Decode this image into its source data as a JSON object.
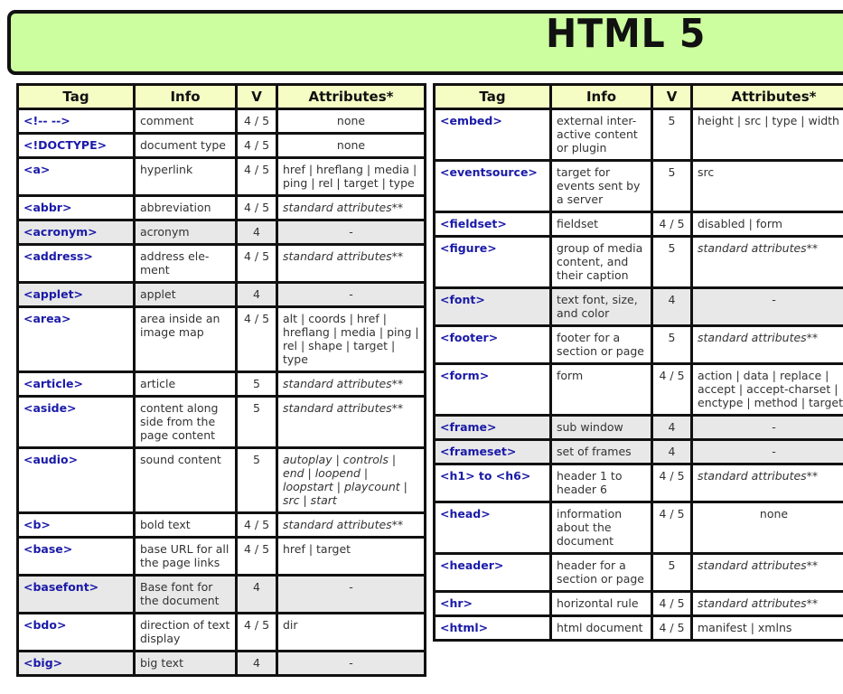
{
  "title": "HTML 5",
  "colors": {
    "banner_bg": "#ccfd9f",
    "header_bg": "#f5fcc4",
    "tag_text": "#1a1aa8",
    "deprecated_row_bg": "#e8e8e8"
  },
  "columns": [
    "Tag",
    "Info",
    "V",
    "Attributes*"
  ],
  "left_table": [
    {
      "tag": "<!--  -->",
      "info": "comment",
      "v": "4 / 5",
      "attr": "none",
      "style": "center",
      "deprecated": false
    },
    {
      "tag": "<!DOCTYPE>",
      "info": "document type",
      "v": "4 / 5",
      "attr": "none",
      "style": "center",
      "deprecated": false
    },
    {
      "tag": "<a>",
      "info": "hyperlink",
      "v": "4 / 5",
      "attr": "href | hreflang | media | ping | rel | target | type",
      "style": "",
      "deprecated": false
    },
    {
      "tag": "<abbr>",
      "info": "abbreviation",
      "v": "4 / 5",
      "attr": "standard attributes**",
      "style": "italic",
      "deprecated": false
    },
    {
      "tag": "<acronym>",
      "info": "acronym",
      "v": "4",
      "attr": "-",
      "style": "center",
      "deprecated": true
    },
    {
      "tag": "<address>",
      "info": "address ele-ment",
      "v": "4 / 5",
      "attr": "standard attributes**",
      "style": "italic",
      "deprecated": false
    },
    {
      "tag": "<applet>",
      "info": "applet",
      "v": "4",
      "attr": "-",
      "style": "center",
      "deprecated": true
    },
    {
      "tag": "<area>",
      "info": "area inside an image map",
      "v": "4 / 5",
      "attr": "alt | coords | href | hreflang | media | ping | rel | shape | target | type",
      "style": "",
      "deprecated": false
    },
    {
      "tag": "<article>",
      "info": "article",
      "v": "5",
      "attr": "standard attributes**",
      "style": "italic",
      "deprecated": false
    },
    {
      "tag": "<aside>",
      "info": "content along side from the page content",
      "v": "5",
      "attr": "standard attributes**",
      "style": "italic",
      "deprecated": false
    },
    {
      "tag": "<audio>",
      "info": "sound content",
      "v": "5",
      "attr": "autoplay | controls | end | loopend | loopstart | playcount | src | start",
      "style": "italic",
      "deprecated": false
    },
    {
      "tag": "<b>",
      "info": "bold text",
      "v": "4 / 5",
      "attr": "standard attributes**",
      "style": "italic",
      "deprecated": false
    },
    {
      "tag": "<base>",
      "info": "base URL for all the page links",
      "v": "4 / 5",
      "attr": "href | target",
      "style": "",
      "deprecated": false
    },
    {
      "tag": "<basefont>",
      "info": "Base font for the document",
      "v": "4",
      "attr": "-",
      "style": "center",
      "deprecated": true
    },
    {
      "tag": "<bdo>",
      "info": "direction of text display",
      "v": "4 / 5",
      "attr": "dir",
      "style": "",
      "deprecated": false
    },
    {
      "tag": "<big>",
      "info": "big text",
      "v": "4",
      "attr": "-",
      "style": "center",
      "deprecated": true
    }
  ],
  "right_table": [
    {
      "tag": "<embed>",
      "info": "external inter-active content or plugin",
      "v": "5",
      "attr": "height | src | type | width",
      "style": "",
      "deprecated": false
    },
    {
      "tag": "<eventsource>",
      "info": "target for events sent by a server",
      "v": "5",
      "attr": "src",
      "style": "",
      "deprecated": false
    },
    {
      "tag": "<fieldset>",
      "info": "fieldset",
      "v": "4 / 5",
      "attr": "disabled | form",
      "style": "",
      "deprecated": false
    },
    {
      "tag": "<figure>",
      "info": "group of media content, and their caption",
      "v": "5",
      "attr": "standard attributes**",
      "style": "italic",
      "deprecated": false
    },
    {
      "tag": "<font>",
      "info": "text font, size, and color",
      "v": "4",
      "attr": "-",
      "style": "center",
      "deprecated": true
    },
    {
      "tag": "<footer>",
      "info": "footer for a section or page",
      "v": "5",
      "attr": "standard attributes**",
      "style": "italic",
      "deprecated": false
    },
    {
      "tag": "<form>",
      "info": "form",
      "v": "4 / 5",
      "attr": "action | data | replace | accept | accept-charset | enctype | method | target",
      "style": "",
      "deprecated": false
    },
    {
      "tag": "<frame>",
      "info": "sub window",
      "v": "4",
      "attr": "-",
      "style": "center",
      "deprecated": true
    },
    {
      "tag": "<frameset>",
      "info": "set of frames",
      "v": "4",
      "attr": "-",
      "style": "center",
      "deprecated": true
    },
    {
      "tag": "<h1> to <h6>",
      "info": "header 1 to header 6",
      "v": "4 / 5",
      "attr": "standard attributes**",
      "style": "italic",
      "deprecated": false
    },
    {
      "tag": "<head>",
      "info": "information about the document",
      "v": "4 / 5",
      "attr": "none",
      "style": "center",
      "deprecated": false
    },
    {
      "tag": "<header>",
      "info": "header for a section or page",
      "v": "5",
      "attr": "standard attributes**",
      "style": "italic",
      "deprecated": false
    },
    {
      "tag": "<hr>",
      "info": "horizontal rule",
      "v": "4 / 5",
      "attr": "standard attributes**",
      "style": "italic",
      "deprecated": false
    },
    {
      "tag": "<html>",
      "info": "html document",
      "v": "4 / 5",
      "attr": "manifest | xmlns",
      "style": "",
      "deprecated": false
    }
  ]
}
